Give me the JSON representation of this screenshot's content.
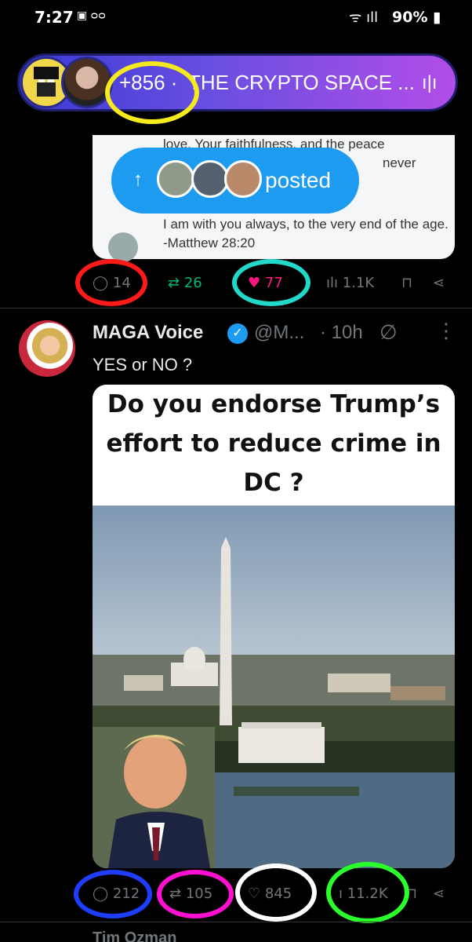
{
  "status_bar": {
    "time": "7:27",
    "left_icons": "▣ ᴑᴑ",
    "signal": "ᯤ ıll",
    "battery": "90% ▮"
  },
  "space": {
    "count": "+856 ·",
    "title": "THE CRYPTO SPACE ...",
    "eq_icon": "ı|ı"
  },
  "prev_tweet": {
    "quote_line1": "love. Your faithfulness, and the peace",
    "quote_line2": "never",
    "quote_line3": "I am with you always, to the very end of the age. -Matthew 28:20",
    "posted_arrow": "↑",
    "posted_label": "posted",
    "actions": {
      "replies": "14",
      "reposts": "26",
      "likes": "77",
      "views": "1.1K"
    }
  },
  "tweet": {
    "author": "MAGA Voice",
    "handle": "@M...",
    "time": "· 10h",
    "text": "YES or NO ?",
    "media_headline": [
      "Do you endorse Trump’s",
      "effort to reduce crime in",
      "DC ?"
    ],
    "actions": {
      "replies": "212",
      "reposts": "105",
      "likes": "845",
      "views": "11.2K"
    }
  },
  "next_tweet": {
    "author_partial": "Tim Ozman"
  },
  "colors": {
    "blue": "#1d9bf0",
    "like": "#f91880",
    "repost": "#00ba7c",
    "muted": "#71767b"
  }
}
